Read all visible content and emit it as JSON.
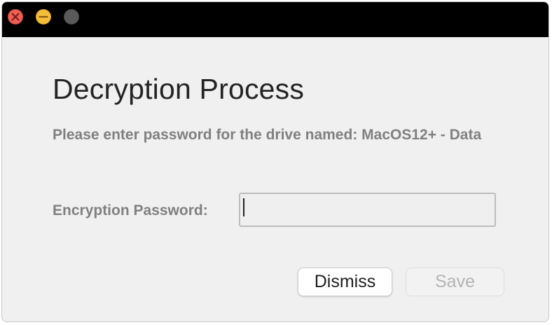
{
  "window": {
    "controls": {
      "close": "close-icon",
      "minimize": "minimize-icon",
      "maximize": "maximize-icon"
    }
  },
  "dialog": {
    "title": "Decryption Process",
    "message": "Please enter password for the drive named: MacOS12+ - Data",
    "password_label": "Encryption Password:",
    "password_value": "",
    "password_placeholder": ""
  },
  "buttons": {
    "dismiss": "Dismiss",
    "save": "Save",
    "save_enabled": false
  },
  "colors": {
    "titlebar": "#000000",
    "background": "#f0f0f0",
    "close": "#ee5f57",
    "minimize": "#f4bd3a",
    "maximize_inactive": "#5a5a5a",
    "label_gray": "#808080"
  }
}
